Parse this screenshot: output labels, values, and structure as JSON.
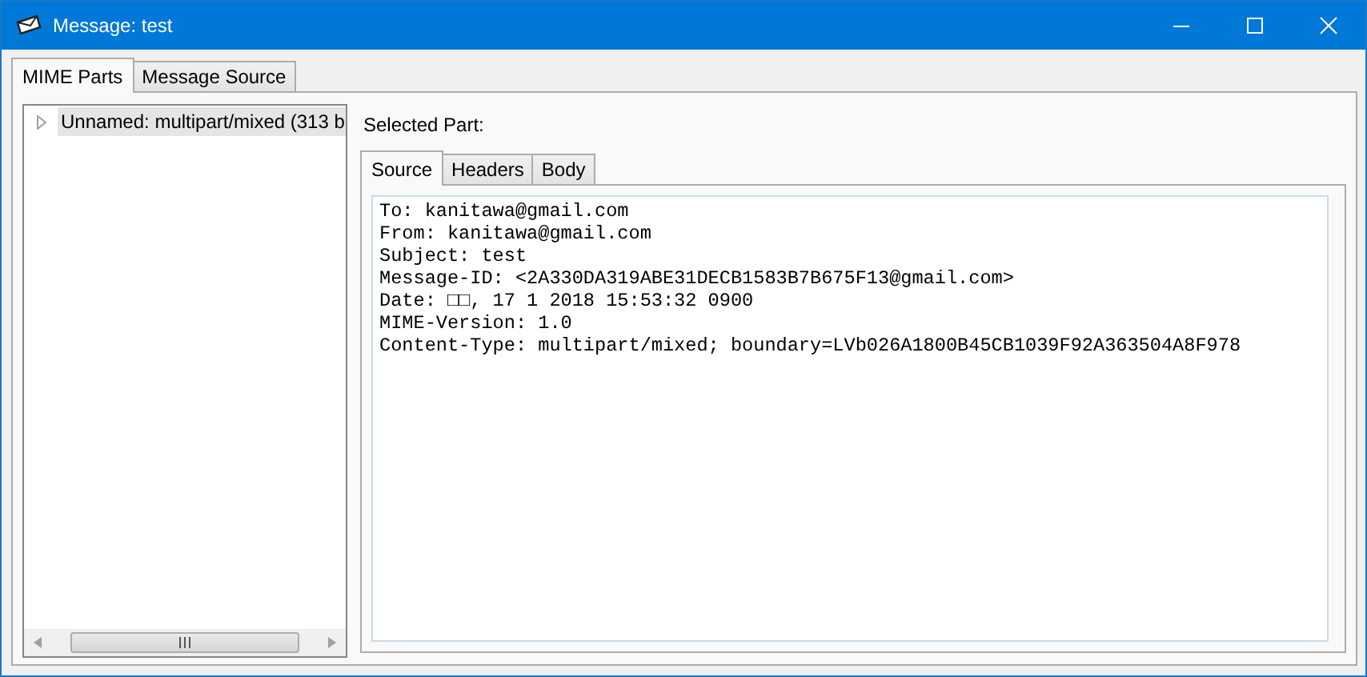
{
  "window": {
    "title": "Message: test"
  },
  "tabs": [
    {
      "label": "MIME Parts",
      "selected": true
    },
    {
      "label": "Message Source",
      "selected": false
    }
  ],
  "tree": {
    "items": [
      {
        "label": "Unnamed: multipart/mixed (313 b",
        "selected": true,
        "expanded": false
      }
    ]
  },
  "detail": {
    "label": "Selected Part:",
    "tabs": [
      {
        "label": "Source",
        "selected": true
      },
      {
        "label": "Headers",
        "selected": false
      },
      {
        "label": "Body",
        "selected": false
      }
    ],
    "source_lines": [
      "To: kanitawa@gmail.com",
      "From: kanitawa@gmail.com",
      "Subject: test",
      "Message-ID: <2A330DA319ABE31DECB1583B7B675F13@gmail.com>",
      "Date: □□, 17 1 2018 15:53:32 0900",
      "MIME-Version: 1.0",
      "Content-Type: multipart/mixed; boundary=LVb026A1800B45CB1039F92A363504A8F978"
    ]
  }
}
